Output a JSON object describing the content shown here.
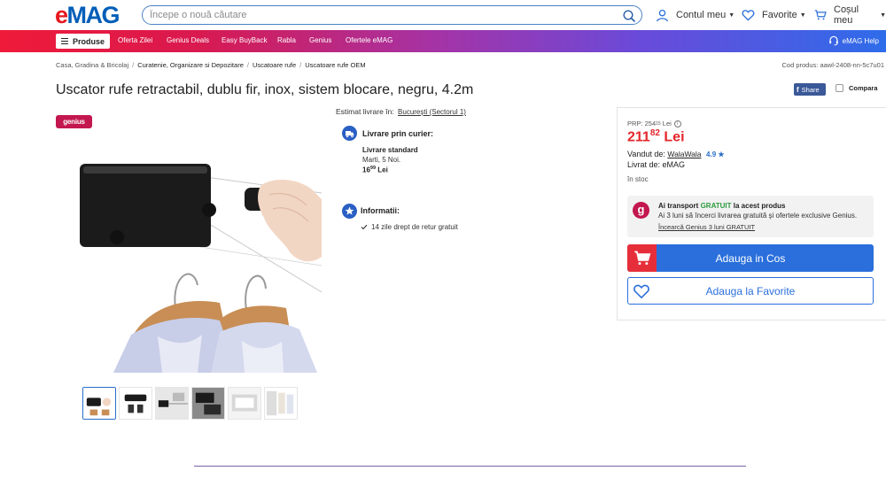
{
  "header": {
    "logo_part1": "e",
    "logo_part2": "MAG",
    "search_placeholder": "Începe o nouă căutare",
    "account": "Contul meu",
    "favorites": "Favorite",
    "cart": "Coșul meu"
  },
  "nav": {
    "products_label": "Produse",
    "items": [
      "Oferta Zilei",
      "Genius Deals",
      "Easy BuyBack",
      "Rabla",
      "Genius",
      "Ofertele eMAG"
    ],
    "help": "eMAG Help"
  },
  "breadcrumb": {
    "items": [
      "Casa, Gradina & Bricolaj",
      "Curatenie, Organizare si Depozitare",
      "Uscatoare rufe",
      "Uscatoare rufe OEM"
    ],
    "product_code": "Cod produs: aawl-2408-nn-5c7u01"
  },
  "product": {
    "title": "Uscator rufe retractabil, dublu fir, inox, sistem blocare, negru, 4.2m",
    "share": "Share",
    "compare": "Compara",
    "genius_badge": "genius"
  },
  "delivery": {
    "estimate_label": "Estimat livrare în:",
    "location": "București (Sectorul 1)",
    "courier_title": "Livrare prin curier:",
    "standard": "Livrare standard",
    "date": "Marti, 5 Noi.",
    "price_int": "16",
    "price_dec": "99",
    "currency": "Lei",
    "info_title": "Informatii:",
    "return_policy": "14 zile drept de retur gratuit"
  },
  "buybox": {
    "prp_label": "PRP:",
    "prp_int": "254",
    "prp_dec": "15",
    "prp_currency": "Lei",
    "price_int": "211",
    "price_dec": "82",
    "currency": "Lei",
    "sold_by_label": "Vandut de:",
    "seller": "WalaWala",
    "rating": "4.9",
    "delivered_by": "Livrat de: eMAG",
    "stock": "în stoc",
    "genius_line1_a": "Ai transport",
    "genius_line1_b": "GRATUIT",
    "genius_line1_c": "la acest produs",
    "genius_line2": "Ai 3 luni să încerci livrarea gratuită și ofertele exclusive Genius.",
    "genius_line3": "Încearcă Genius 3 luni GRATUIT",
    "add_to_cart": "Adauga in Cos",
    "add_to_fav": "Adauga la Favorite"
  },
  "colors": {
    "brand_red": "#e6181e",
    "brand_blue": "#005eb8",
    "price_red": "#e3262b",
    "genius_pink": "#c3174f",
    "action_blue": "#2a6fdb"
  }
}
